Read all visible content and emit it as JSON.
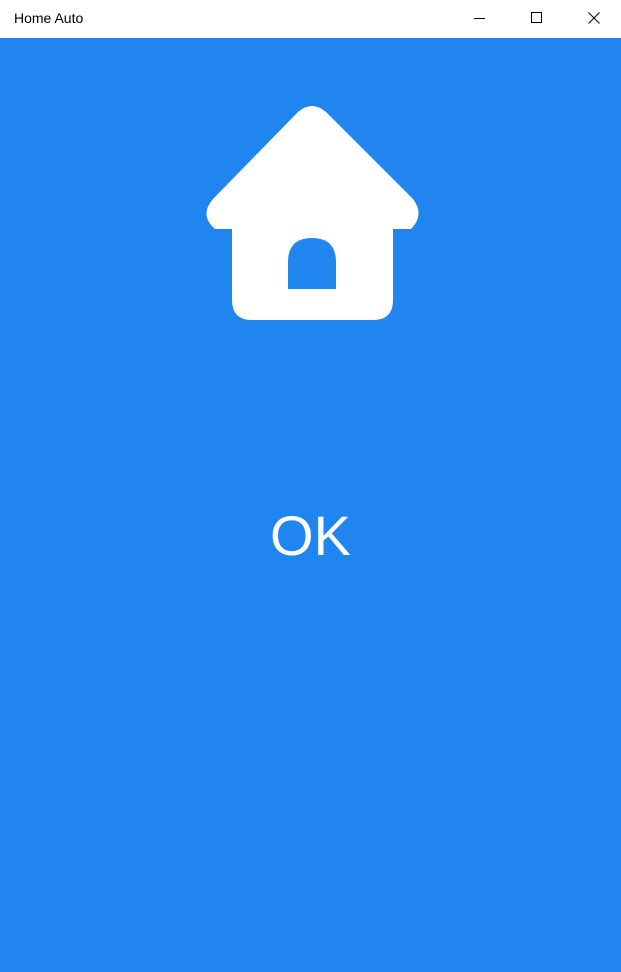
{
  "window": {
    "title": "Home Auto",
    "buttons": {
      "minimize_icon": "minimize-icon",
      "maximize_icon": "maximize-icon",
      "close_icon": "close-icon"
    }
  },
  "main": {
    "icon": "home-icon",
    "status": "OK",
    "background_color": "#2185f0",
    "foreground_color": "#ffffff"
  }
}
